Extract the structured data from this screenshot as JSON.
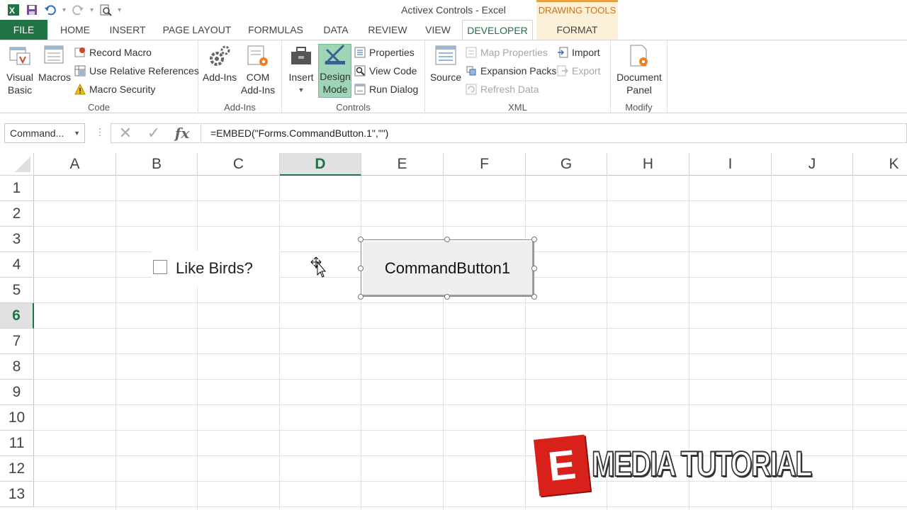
{
  "window": {
    "title": "Activex Controls - Excel"
  },
  "qat": {
    "icons": [
      "excel-logo-icon",
      "save-icon",
      "undo-icon",
      "redo-icon",
      "print-preview-icon",
      "customize-icon"
    ]
  },
  "context_tab": {
    "title": "DRAWING TOOLS",
    "color": "#c6741c"
  },
  "tabs": [
    {
      "label": "FILE"
    },
    {
      "label": "HOME"
    },
    {
      "label": "INSERT"
    },
    {
      "label": "PAGE LAYOUT"
    },
    {
      "label": "FORMULAS"
    },
    {
      "label": "DATA"
    },
    {
      "label": "REVIEW"
    },
    {
      "label": "VIEW"
    },
    {
      "label": "DEVELOPER"
    },
    {
      "label": "FORMAT"
    }
  ],
  "active_tab": "DEVELOPER",
  "ribbon": {
    "code": {
      "label": "Code",
      "visual_basic_1": "Visual",
      "visual_basic_2": "Basic",
      "macros": "Macros",
      "record_macro": "Record Macro",
      "relative_refs": "Use Relative References",
      "macro_security": "Macro Security"
    },
    "addins": {
      "label": "Add-Ins",
      "addins": "Add-Ins",
      "com_1": "COM",
      "com_2": "Add-Ins"
    },
    "controls": {
      "label": "Controls",
      "insert": "Insert",
      "design_1": "Design",
      "design_2": "Mode",
      "properties": "Properties",
      "view_code": "View Code",
      "run_dialog": "Run Dialog"
    },
    "xml": {
      "label": "XML",
      "source": "Source",
      "map_properties": "Map Properties",
      "expansion_packs": "Expansion Packs",
      "refresh_data": "Refresh Data",
      "import": "Import",
      "export": "Export"
    },
    "modify": {
      "label": "Modify",
      "doc_1": "Document",
      "doc_2": "Panel"
    }
  },
  "formula_bar": {
    "name_box": "Command...",
    "fx": "fx",
    "formula": "=EMBED(\"Forms.CommandButton.1\",\"\")"
  },
  "grid": {
    "columns": [
      "A",
      "B",
      "C",
      "D",
      "E",
      "F",
      "G",
      "H",
      "I",
      "J",
      "K"
    ],
    "rows": [
      "1",
      "2",
      "3",
      "4",
      "5",
      "6",
      "7",
      "8",
      "9",
      "10",
      "11",
      "12",
      "13"
    ],
    "selected_column": "D",
    "selected_row": "6"
  },
  "controls": {
    "checkbox_label": "Like Birds?",
    "checkbox_checked": false,
    "command_button_label": "CommandButton1"
  },
  "watermark": {
    "logo_letter": "E",
    "text": "MEDIA TUTORIAL"
  },
  "colors": {
    "excel_green": "#217346",
    "design_mode_highlight": "#9fd5b7"
  }
}
